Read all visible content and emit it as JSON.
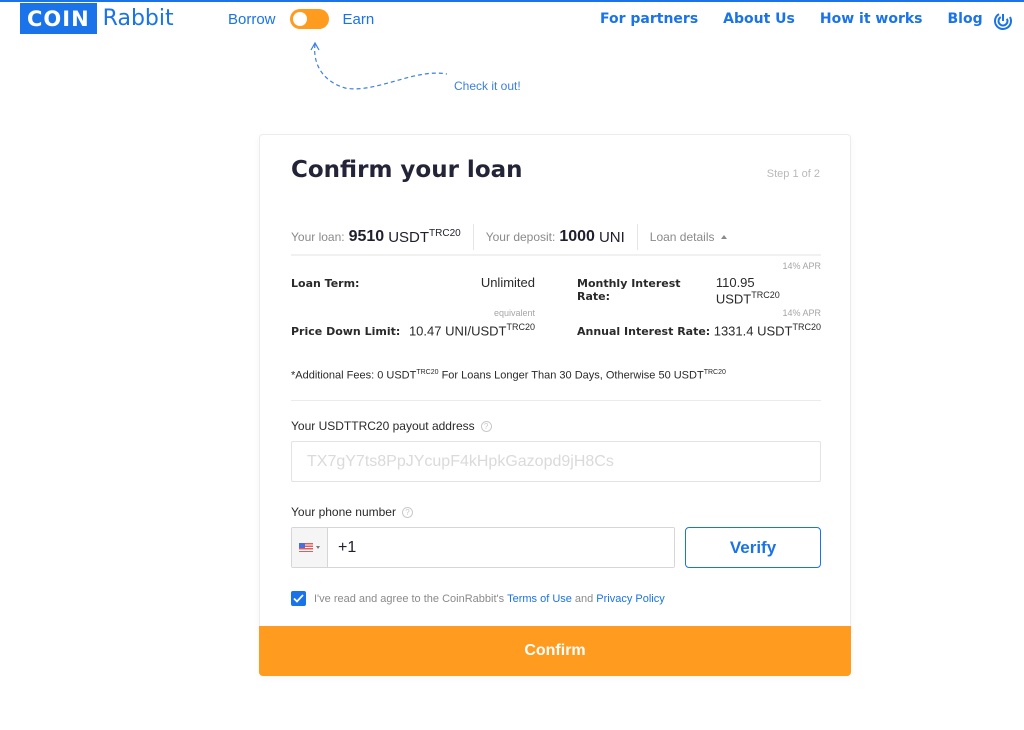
{
  "header": {
    "logo": {
      "part1": "COIN",
      "part2": "Rabbit"
    },
    "mode_toggle": {
      "left_label": "Borrow",
      "right_label": "Earn",
      "state": "borrow"
    },
    "hint": "Check it out!",
    "nav": [
      {
        "label": "For partners"
      },
      {
        "label": "About Us"
      },
      {
        "label": "How it works"
      },
      {
        "label": "Blog"
      }
    ],
    "nav_icon": "support-radar-icon"
  },
  "card": {
    "title": "Confirm your loan",
    "step": "Step 1 of 2",
    "summary": {
      "loan_label": "Your loan:",
      "loan_amount": "9510",
      "loan_currency": "USDT",
      "loan_network": "TRC20",
      "deposit_label": "Your deposit:",
      "deposit_amount": "1000",
      "deposit_currency": "UNI",
      "details_label": "Loan details"
    },
    "details": {
      "loan_term_label": "Loan Term:",
      "loan_term_value": "Unlimited",
      "price_down_label": "Price Down Limit:",
      "price_down_value": "10.47 UNI/USDT",
      "price_down_network": "TRC20",
      "price_down_note": "equivalent",
      "monthly_label": "Monthly Interest Rate:",
      "monthly_value": "110.95 USDT",
      "monthly_network": "TRC20",
      "monthly_note": "14% APR",
      "annual_label": "Annual Interest Rate:",
      "annual_value": "1331.4 USDT",
      "annual_network": "TRC20",
      "annual_note": "14% APR"
    },
    "fees": {
      "prefix": "*Additional Fees: 0 USDT",
      "network1": "TRC20",
      "middle": " For Loans Longer Than 30 Days, Otherwise 50 USDT",
      "network2": "TRC20"
    },
    "payout": {
      "label": "Your USDTTRC20 payout address",
      "placeholder": "TX7gY7ts8PpJYcupF4kHpkGazopd9jH8Cs",
      "value": ""
    },
    "phone": {
      "label": "Your phone number",
      "country": "US",
      "value": "+1",
      "verify_label": "Verify"
    },
    "agreement": {
      "checked": true,
      "text": "I've read and agree to the CoinRabbit's",
      "terms_label": "Terms of Use",
      "and": "and",
      "privacy_label": "Privacy Policy"
    },
    "confirm_label": "Confirm"
  },
  "colors": {
    "brand_blue": "#1a73e8",
    "accent_orange": "#ff9b1e"
  }
}
